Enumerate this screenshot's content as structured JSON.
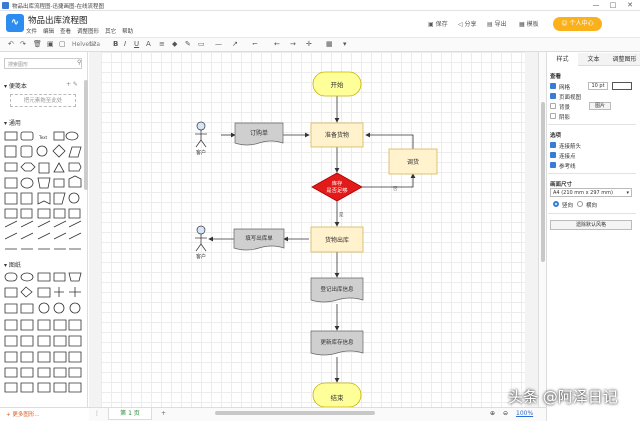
{
  "window": {
    "title": "物品出库流程图-迅捷画图-在线流程图",
    "min": "—",
    "max": "□",
    "close": "✕"
  },
  "app": {
    "doc_title": "物品出库流程图",
    "menu": [
      "文件",
      "编辑",
      "查看",
      "调整图形",
      "其它",
      "帮助"
    ],
    "actions": {
      "save": "保存",
      "share": "分享",
      "export": "导出",
      "template": "模板",
      "personal": "个人中心"
    }
  },
  "toolbar": {
    "font": "Helvetica",
    "size": "12"
  },
  "sidebar": {
    "search_placeholder": "搜索图形",
    "scratchpad": "便笺本",
    "scratchpad_hint": "把元素拖至此处",
    "general": "通用",
    "misc": "图纸",
    "more_shapes": "更多图形..."
  },
  "flow": {
    "start": "开始",
    "prepare": "准备货物",
    "order": "订购单",
    "customer1": "客户",
    "adjust": "调货",
    "decision": "库存\n是否足够",
    "yes_label": "是",
    "no_label": "否",
    "form": "填写出库单",
    "customer2": "客户",
    "ship": "货物出库",
    "register": "登记出库信息",
    "update": "更新库存信息",
    "end": "结束"
  },
  "right_panel": {
    "tabs": [
      "样式",
      "文本",
      "调整图形"
    ],
    "view": "查看",
    "grid": "网格",
    "grid_size": "10 pt",
    "page_view": "页面视图",
    "background": "背景",
    "image_btn": "图片",
    "shadow": "阴影",
    "options": "选项",
    "connection_arrows": "连接箭头",
    "connection_points": "连接点",
    "guides": "参考线",
    "paper_size": "画面尺寸",
    "paper_value": "A4 (210 mm x 297 mm)",
    "portrait": "竖向",
    "landscape": "横向",
    "reset_btn": "遗除默认风格"
  },
  "bottom": {
    "page_tab": "第 1 页",
    "add": "+",
    "zoom": "100%",
    "zoom_in": "⊕",
    "zoom_out": "⊖"
  },
  "watermark": "头条 @阿泽日记",
  "colors": {
    "start_end": "#ffff99",
    "process": "#fff2cc",
    "decision": "#e31a1a",
    "doc": "#cfcfcf",
    "accent": "#2d8cf0",
    "upgrade": "#fbb11b"
  }
}
